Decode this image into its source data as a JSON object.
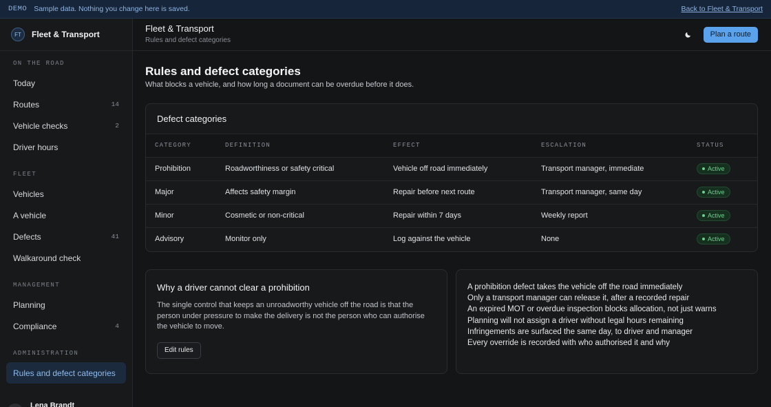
{
  "banner": {
    "tag": "DEMO",
    "message": "Sample data. Nothing you change here is saved.",
    "back_link": "Back to Fleet & Transport"
  },
  "brand": {
    "initials": "FT",
    "name": "Fleet & Transport"
  },
  "sidebar": {
    "sections": [
      {
        "heading": "ON THE ROAD",
        "items": [
          {
            "label": "Today",
            "count": ""
          },
          {
            "label": "Routes",
            "count": "14"
          },
          {
            "label": "Vehicle checks",
            "count": "2"
          },
          {
            "label": "Driver hours",
            "count": ""
          }
        ]
      },
      {
        "heading": "FLEET",
        "items": [
          {
            "label": "Vehicles",
            "count": ""
          },
          {
            "label": "A vehicle",
            "count": ""
          },
          {
            "label": "Defects",
            "count": "41"
          },
          {
            "label": "Walkaround check",
            "count": ""
          }
        ]
      },
      {
        "heading": "MANAGEMENT",
        "items": [
          {
            "label": "Planning",
            "count": ""
          },
          {
            "label": "Compliance",
            "count": "4"
          }
        ]
      },
      {
        "heading": "ADMINISTRATION",
        "items": [
          {
            "label": "Rules and defect categories",
            "count": "",
            "active": true
          }
        ]
      }
    ],
    "user": {
      "initials": "LB",
      "name": "Lena Brandt"
    }
  },
  "header": {
    "title": "Fleet & Transport",
    "subtitle": "Rules and defect categories",
    "theme_icon": "moon-icon",
    "primary_action": "Plan a route"
  },
  "page": {
    "title": "Rules and defect categories",
    "subtitle": "What blocks a vehicle, and how long a document can be overdue before it does."
  },
  "defects": {
    "title": "Defect categories",
    "columns": [
      "CATEGORY",
      "DEFINITION",
      "EFFECT",
      "ESCALATION",
      "STATUS"
    ],
    "rows": [
      [
        "Prohibition",
        "Roadworthiness or safety critical",
        "Vehicle off road immediately",
        "Transport manager, immediate",
        "Active"
      ],
      [
        "Major",
        "Affects safety margin",
        "Repair before next route",
        "Transport manager, same day",
        "Active"
      ],
      [
        "Minor",
        "Cosmetic or non-critical",
        "Repair within 7 days",
        "Weekly report",
        "Active"
      ],
      [
        "Advisory",
        "Monitor only",
        "Log against the vehicle",
        "None",
        "Active"
      ]
    ],
    "status_color": "#6fcf8e"
  },
  "why": {
    "title": "Why a driver cannot clear a prohibition",
    "body": "The single control that keeps an unroadworthy vehicle off the road is that the person under pressure to make the delivery is not the person who can authorise the vehicle to move.",
    "button": "Edit rules"
  },
  "rules": [
    "A prohibition defect takes the vehicle off the road immediately",
    "Only a transport manager can release it, after a recorded repair",
    "An expired MOT or overdue inspection blocks allocation, not just warns",
    "Planning will not assign a driver without legal hours remaining",
    "Infringements are surfaced the same day, to driver and manager",
    "Every override is recorded with who authorised it and why"
  ],
  "colors": {
    "accent": "#5aa3ec",
    "background": "#141517",
    "banner": "#16253a"
  }
}
